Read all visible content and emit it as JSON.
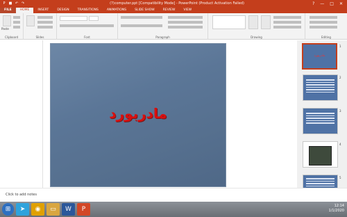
{
  "window": {
    "title": "‏‎(?)computer.ppt [‏‎Compatibility Mode] - PowerPoint (Product Activation Failed)",
    "help": "?",
    "minimize": "—",
    "maximize": "□",
    "close": "✕"
  },
  "tabs": [
    "FILE",
    "HOME",
    "INSERT",
    "DESIGN",
    "TRANSITIONS",
    "ANIMATIONS",
    "SLIDE SHOW",
    "REVIEW",
    "VIEW"
  ],
  "ribbon": {
    "groups": [
      "Clipboard",
      "Slides",
      "Font",
      "Paragraph",
      "Drawing",
      "Editing"
    ],
    "paste_label": "Paste"
  },
  "slide": {
    "title": "مادربورد"
  },
  "thumbnails": [
    {
      "number": "1",
      "title": "مادربورد"
    },
    {
      "number": "2"
    },
    {
      "number": "3"
    },
    {
      "number": "4"
    },
    {
      "number": "5"
    }
  ],
  "status": {
    "notes_hint": "Click to add notes"
  },
  "taskbar": {
    "apps": [
      "start",
      "telegram",
      "chrome",
      "explorer",
      "word",
      "powerpoint"
    ],
    "time": "12:14",
    "date": "1/1/2020"
  }
}
